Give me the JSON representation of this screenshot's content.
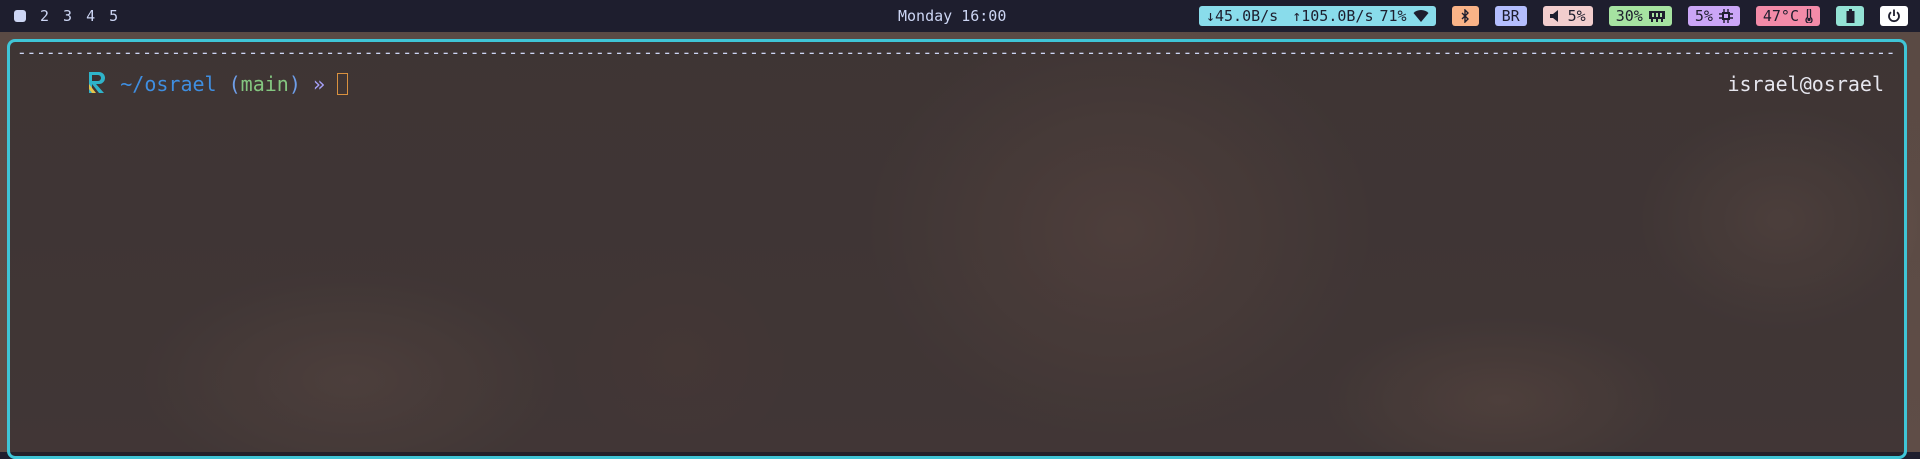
{
  "workspaces": {
    "active_icon": "filled-square",
    "items": [
      "2",
      "3",
      "4",
      "5"
    ]
  },
  "clock": "Monday 16:00",
  "modules": {
    "network": {
      "down": "↓45.0B/s",
      "up": "↑105.0B/s",
      "signal": "71%",
      "icon": "wifi-icon",
      "color": "#89dceb"
    },
    "bluetooth": {
      "icon": "bluetooth-icon",
      "color": "#fab387"
    },
    "keyboard_layout": {
      "label": "BR",
      "color": "#b4befe"
    },
    "volume": {
      "label": "5%",
      "icon": "speaker-icon",
      "color": "#f2cdcd"
    },
    "memory": {
      "label": "30%",
      "icon": "memory-icon",
      "color": "#a6e3a1"
    },
    "cpu": {
      "label": "5%",
      "icon": "cpu-icon",
      "color": "#cba6f7"
    },
    "temperature": {
      "label": "47°C",
      "icon": "thermometer-icon",
      "color": "#f38ba8"
    },
    "battery": {
      "icon": "battery-icon",
      "color": "#94e2d5"
    },
    "power": {
      "icon": "power-icon",
      "color": "#ffffff"
    }
  },
  "terminal": {
    "rule": "--------------------------------------------------------------------------------------------------------------------------------------------------------------------------------------------------------------------------------------",
    "cwd": "~/osrael",
    "paren_open": "(",
    "branch": "main",
    "paren_close": ")",
    "prompt_symbol": "»",
    "user_host": "israel@osrael",
    "border_color": "#3fc5d6"
  }
}
